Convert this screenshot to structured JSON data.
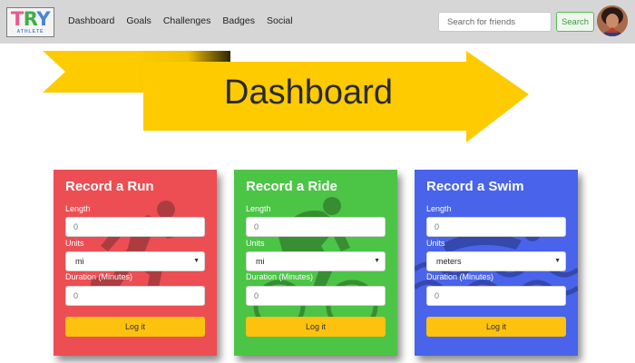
{
  "app": {
    "brand_main": "TRY",
    "brand_sub": "ATHLETE"
  },
  "nav": {
    "items": [
      {
        "label": "Dashboard"
      },
      {
        "label": "Goals"
      },
      {
        "label": "Challenges"
      },
      {
        "label": "Badges"
      },
      {
        "label": "Social"
      }
    ],
    "search_placeholder": "Search for friends",
    "search_button": "Search"
  },
  "banner": {
    "title": "Dashboard",
    "color": "#fecb00"
  },
  "cards": [
    {
      "title": "Record a Run",
      "color": "#ec4e53",
      "icon": "runner-icon",
      "length_label": "Length",
      "length_placeholder": "0",
      "units_label": "Units",
      "units_value": "mi",
      "duration_label": "Duration (Minutes)",
      "duration_placeholder": "0",
      "button": "Log it"
    },
    {
      "title": "Record a Ride",
      "color": "#4cc446",
      "icon": "cyclist-icon",
      "length_label": "Length",
      "length_placeholder": "0",
      "units_label": "Units",
      "units_value": "mi",
      "duration_label": "Duration (Minutes)",
      "duration_placeholder": "0",
      "button": "Log it"
    },
    {
      "title": "Record a Swim",
      "color": "#4963ea",
      "icon": "swimmer-icon",
      "length_label": "Length",
      "length_placeholder": "0",
      "units_label": "Units",
      "units_value": "meters",
      "duration_label": "Duration (Minutes)",
      "duration_placeholder": "0",
      "button": "Log it"
    }
  ],
  "colors": {
    "navbar": "#d6d6d6",
    "button": "#fdc10f",
    "search_accent": "#5cb85c"
  }
}
